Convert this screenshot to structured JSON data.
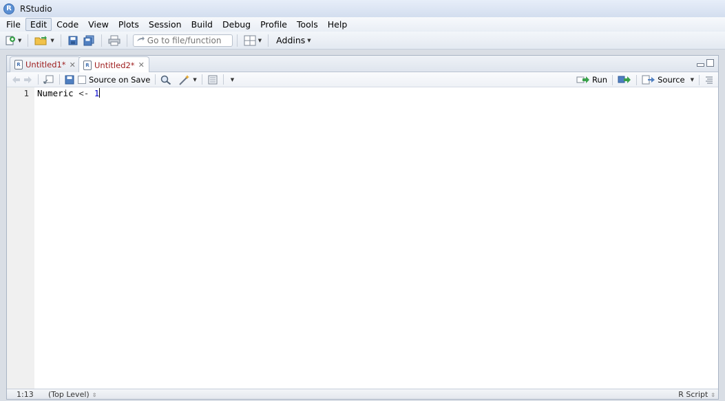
{
  "window": {
    "title": "RStudio",
    "logo_letter": "R"
  },
  "menubar": {
    "items": [
      "File",
      "Edit",
      "Code",
      "View",
      "Plots",
      "Session",
      "Build",
      "Debug",
      "Profile",
      "Tools",
      "Help"
    ],
    "active": "Edit"
  },
  "toolbar": {
    "goto_placeholder": "Go to file/function",
    "addins_label": "Addins"
  },
  "tabs": [
    {
      "label": "Untitled1*",
      "selected": false
    },
    {
      "label": "Untitled2*",
      "selected": true
    }
  ],
  "editor_toolbar": {
    "source_on_save_label": "Source on Save",
    "run_label": "Run",
    "source_label": "Source"
  },
  "editor": {
    "lines": [
      {
        "number": "1",
        "tokens": [
          {
            "t": "Numeric",
            "c": "tok-id"
          },
          {
            "t": " <- ",
            "c": "tok-op"
          },
          {
            "t": "1",
            "c": "tok-num"
          }
        ]
      }
    ]
  },
  "statusbar": {
    "position": "1:13",
    "scope": "(Top Level)",
    "file_type": "R Script"
  },
  "colors": {
    "tab_text": "#9d1b1b",
    "number_literal": "#0000cc",
    "accent": "#5a8fd3"
  }
}
